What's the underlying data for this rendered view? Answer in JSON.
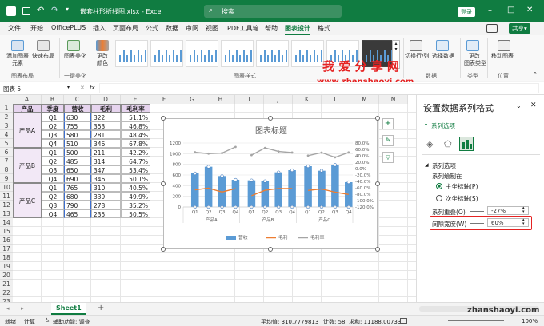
{
  "titlebar": {
    "filename": "嵌套柱形折线图.xlsx",
    "separator": "-",
    "app": "Excel",
    "search_placeholder": "搜索",
    "login": "登录"
  },
  "tabs": [
    "文件",
    "开始",
    "OfficePLUS",
    "插入",
    "页面布局",
    "公式",
    "数据",
    "审阅",
    "视图",
    "PDF工具箱",
    "帮助",
    "图表设计",
    "格式"
  ],
  "share": "共享",
  "ribbon": {
    "add_element": "添加图表\n元素",
    "quick_layout": "快速布局",
    "group_layout": "图表布局",
    "beautify": "图表美化",
    "group_beautify": "一键美化",
    "change_color": "更改\n颜色",
    "group_styles": "图表样式",
    "switch_rowcol": "切换行/列",
    "select_data": "选择数据",
    "group_data": "数据",
    "change_type": "更改\n图表类型",
    "group_type": "类型",
    "move_chart": "移动图表",
    "group_location": "位置"
  },
  "namebox": "图表 5",
  "fx": "fx",
  "watermark_cn": "我 爱 分 享 网",
  "watermark_url": "www.zhanshaoyi.com",
  "watermark_bottom": "zhanshaoyi.com",
  "columns": [
    "A",
    "B",
    "C",
    "D",
    "E",
    "F",
    "G",
    "H",
    "I",
    "J",
    "K",
    "L",
    "M",
    "N"
  ],
  "rows": [
    "1",
    "2",
    "3",
    "4",
    "5",
    "6",
    "7",
    "8",
    "9",
    "10",
    "11",
    "12",
    "13",
    "14",
    "15",
    "16",
    "17",
    "18",
    "19",
    "20",
    "21",
    "22",
    "23"
  ],
  "table": {
    "headers": [
      "产品",
      "季度",
      "营收",
      "毛利",
      "毛利率"
    ],
    "groups": [
      "产品A",
      "产品B",
      "产品C"
    ],
    "data": [
      [
        "Q1",
        "630",
        "322",
        "51.1%"
      ],
      [
        "Q2",
        "755",
        "353",
        "46.8%"
      ],
      [
        "Q3",
        "580",
        "281",
        "48.4%"
      ],
      [
        "Q4",
        "510",
        "346",
        "67.8%"
      ],
      [
        "Q1",
        "500",
        "211",
        "42.2%"
      ],
      [
        "Q2",
        "485",
        "314",
        "64.7%"
      ],
      [
        "Q3",
        "650",
        "347",
        "53.4%"
      ],
      [
        "Q4",
        "690",
        "346",
        "50.1%"
      ],
      [
        "Q1",
        "765",
        "310",
        "40.5%"
      ],
      [
        "Q2",
        "680",
        "339",
        "49.9%"
      ],
      [
        "Q3",
        "790",
        "278",
        "35.2%"
      ],
      [
        "Q4",
        "465",
        "235",
        "50.5%"
      ]
    ]
  },
  "chart_data": {
    "type": "bar",
    "title": "图表标题",
    "categories": [
      "Q1",
      "Q2",
      "Q3",
      "Q4",
      "Q1",
      "Q2",
      "Q3",
      "Q4",
      "Q1",
      "Q2",
      "Q3",
      "Q4"
    ],
    "groups": [
      "产品A",
      "产品B",
      "产品C"
    ],
    "series": [
      {
        "name": "营收",
        "type": "bar",
        "axis": "left",
        "color": "#5b9bd5",
        "values": [
          630,
          755,
          580,
          510,
          500,
          485,
          650,
          690,
          765,
          680,
          790,
          465
        ]
      },
      {
        "name": "毛利",
        "type": "line",
        "axis": "left",
        "color": "#ed7d31",
        "values": [
          322,
          353,
          281,
          346,
          211,
          314,
          347,
          346,
          310,
          339,
          278,
          235
        ]
      },
      {
        "name": "毛利率",
        "type": "line",
        "axis": "right",
        "color": "#a5a5a5",
        "values": [
          51.1,
          46.8,
          48.4,
          67.8,
          42.2,
          64.7,
          53.4,
          50.1,
          40.5,
          49.9,
          35.2,
          50.5
        ]
      }
    ],
    "y_left": {
      "ticks": [
        "0",
        "200",
        "400",
        "600",
        "800",
        "1000",
        "1200"
      ],
      "range": [
        0,
        1200
      ]
    },
    "y_right": {
      "ticks": [
        "-120.0%",
        "-100.0%",
        "-80.0%",
        "-60.0%",
        "-40.0%",
        "-20.0%",
        "0.0%",
        "20.0%",
        "40.0%",
        "60.0%",
        "80.0%"
      ],
      "range": [
        -120,
        80
      ]
    },
    "legend_position": "bottom",
    "grid": true
  },
  "panel": {
    "title": "设置数据系列格式",
    "options_menu": "系列选项",
    "section": "系列选项",
    "plot_on": "系列绘制在",
    "primary": "主坐标轴(P)",
    "secondary": "次坐标轴(S)",
    "overlap_label": "系列重叠(O)",
    "overlap_value": "-27%",
    "gap_label": "间隙宽度(W)",
    "gap_value": "60%"
  },
  "sheet_tab": "Sheet1",
  "status": {
    "ready": "就绪",
    "calc": "计算",
    "accessibility": "辅助功能: 调查",
    "average": "平均值: 310.7779813",
    "count": "计数: 58",
    "sum": "求和: 11188.00733",
    "zoom": "100%"
  }
}
